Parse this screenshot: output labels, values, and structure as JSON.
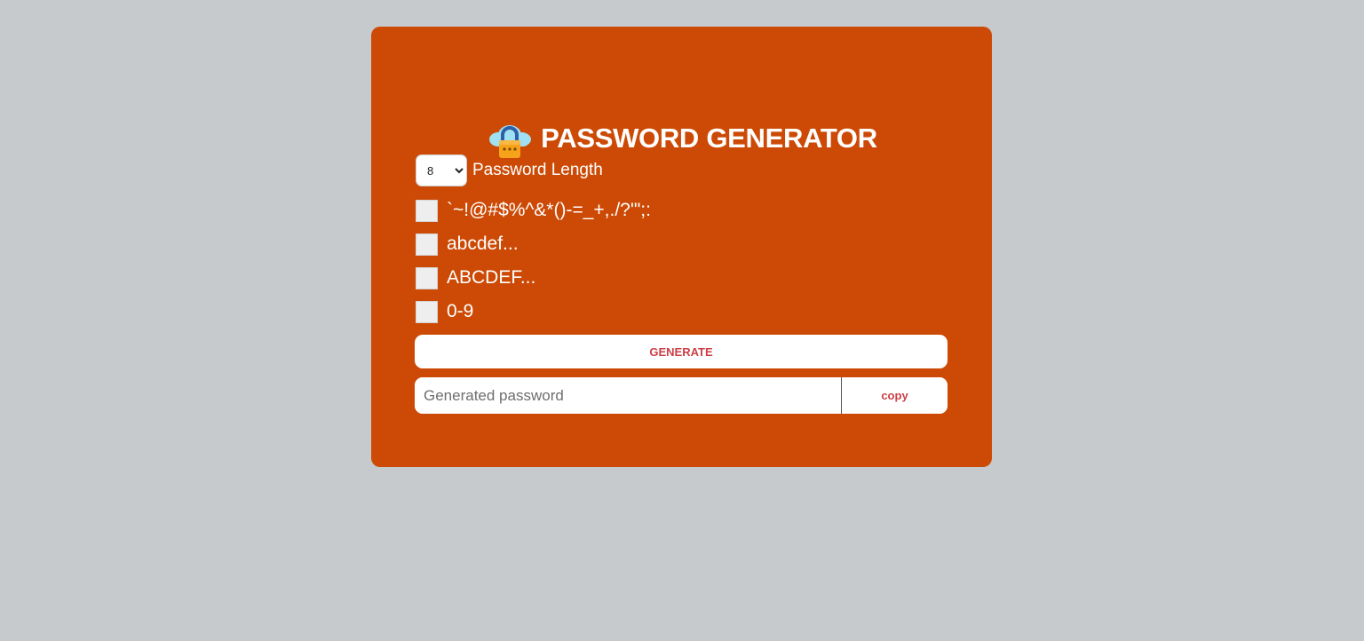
{
  "header": {
    "logo_icon": "cloud-lock-icon",
    "title": "PASSWORD GENERATOR"
  },
  "length": {
    "selected": "8",
    "label": "Password Length"
  },
  "options": [
    {
      "label": "`~!@#$%^&*()-=_+,./?'\";:",
      "checked": false
    },
    {
      "label": "abcdef...",
      "checked": false
    },
    {
      "label": "ABCDEF...",
      "checked": false
    },
    {
      "label": "0-9",
      "checked": false
    }
  ],
  "generate": {
    "label": "GENERATE"
  },
  "output": {
    "value": "",
    "placeholder": "Generated password",
    "copy_label": "copy"
  },
  "colors": {
    "page_background": "#c6cacd",
    "card": "#cc4a05",
    "button_text": "#cc3f46",
    "white": "#ffffff"
  }
}
